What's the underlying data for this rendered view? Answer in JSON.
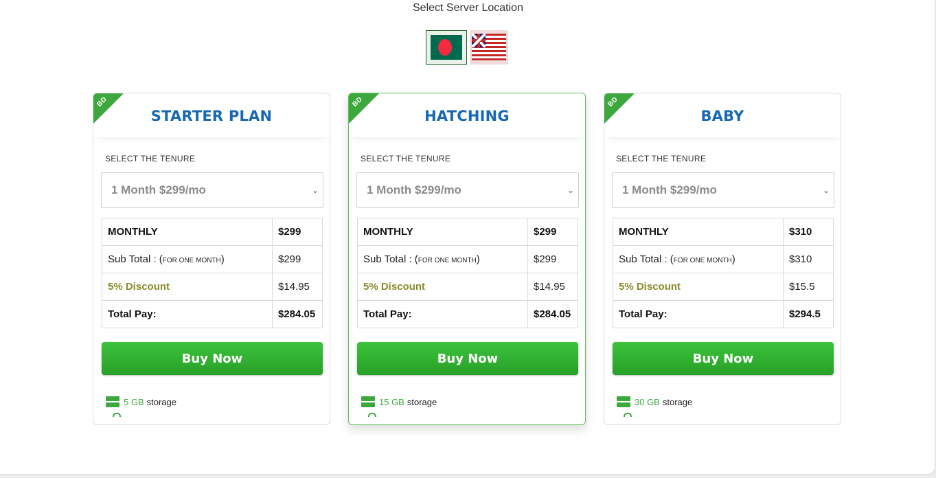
{
  "header": {
    "title": "Select Server Location"
  },
  "locations": [
    {
      "code": "BD",
      "icon": "bangladesh-flag-icon",
      "selected": true
    },
    {
      "code": "US",
      "icon": "us-flag-icon",
      "selected": false
    }
  ],
  "plans": [
    {
      "ribbon": "BD",
      "name": "STARTER PLAN",
      "tenure_label": "SELECT THE TENURE",
      "tenure_selected": "1 Month $299/mo",
      "monthly_label": "MONTHLY",
      "monthly_value": "$299",
      "subtotal_label": "Sub Total : (",
      "subtotal_note": "FOR ONE MONTH",
      "subtotal_close": ")",
      "subtotal_value": "$299",
      "discount_label": "5% Discount",
      "discount_value": "$14.95",
      "total_label": "Total Pay:",
      "total_value": "$284.05",
      "buy_label": "Buy Now",
      "storage_amount": "5 GB",
      "storage_label": "storage"
    },
    {
      "ribbon": "BD",
      "name": "HATCHING",
      "tenure_label": "SELECT THE TENURE",
      "tenure_selected": "1 Month $299/mo",
      "monthly_label": "MONTHLY",
      "monthly_value": "$299",
      "subtotal_label": "Sub Total : (",
      "subtotal_note": "FOR ONE MONTH",
      "subtotal_close": ")",
      "subtotal_value": "$299",
      "discount_label": "5% Discount",
      "discount_value": "$14.95",
      "total_label": "Total Pay:",
      "total_value": "$284.05",
      "buy_label": "Buy Now",
      "storage_amount": "15 GB",
      "storage_label": "storage"
    },
    {
      "ribbon": "BD",
      "name": "BABY",
      "tenure_label": "SELECT THE TENURE",
      "tenure_selected": "1 Month $299/mo",
      "monthly_label": "MONTHLY",
      "monthly_value": "$310",
      "subtotal_label": "Sub Total : (",
      "subtotal_note": "FOR ONE MONTH",
      "subtotal_close": ")",
      "subtotal_value": "$310",
      "discount_label": "5% Discount",
      "discount_value": "$15.5",
      "total_label": "Total Pay:",
      "total_value": "$294.5",
      "buy_label": "Buy Now",
      "storage_amount": "30 GB",
      "storage_label": "storage"
    }
  ],
  "colors": {
    "accent_green": "#3ea83e",
    "plan_title_blue": "#1769b5",
    "discount_olive": "#8a8a2a"
  }
}
